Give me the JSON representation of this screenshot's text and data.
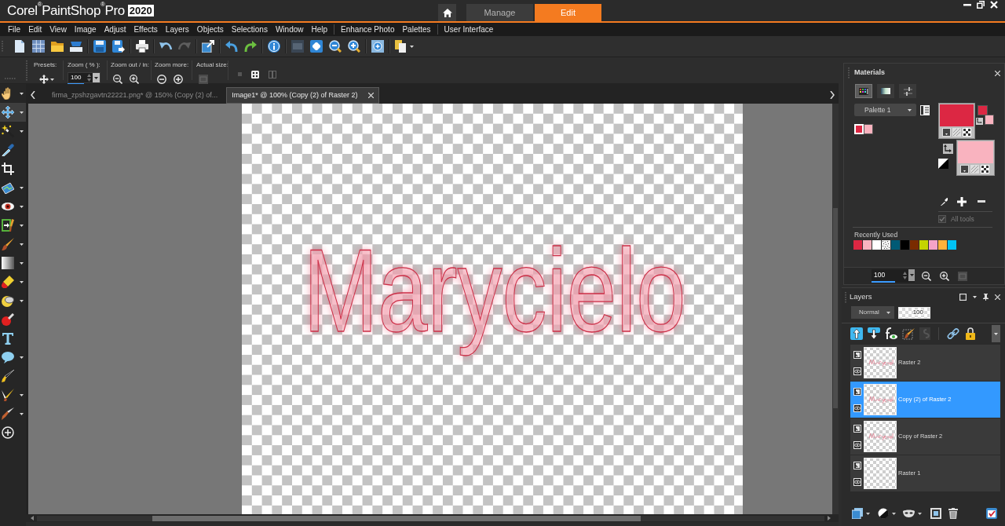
{
  "app": {
    "logo": "Corel$^{®}$PaintShop$^{®}$Pro",
    "edition": "2020",
    "workspace_tabs": [
      {
        "label": "Manage",
        "selected": false
      },
      {
        "label": "Edit",
        "selected": true
      }
    ]
  },
  "menu": [
    [
      "File",
      "Edit",
      "View",
      "Image",
      "Adjust",
      "Effects",
      "Layers",
      "Objects",
      "Selections",
      "Window",
      "Help"
    ],
    [
      "Enhance Photo",
      "Palettes"
    ],
    [
      "User Interface"
    ]
  ],
  "tool_options": {
    "presets": {
      "label": "Presets:"
    },
    "zoom": {
      "label": "Zoom ( % ):",
      "value": "100",
      "level": 0.5
    },
    "zoom_out_in": {
      "label": "Zoom out / in:"
    },
    "zoom_more": {
      "label": "Zoom more:"
    },
    "actual_size": {
      "label": "Actual size:"
    }
  },
  "toolbox": [
    {
      "kind": "pan",
      "selected": false,
      "flyout": true
    },
    {
      "kind": "move",
      "selected": true,
      "flyout": true
    },
    {
      "kind": "magic-wand",
      "selected": false,
      "flyout": true
    },
    {
      "kind": "dropper",
      "selected": false,
      "flyout": false
    },
    {
      "kind": "crop",
      "selected": false,
      "flyout": false
    },
    {
      "kind": "straighten",
      "selected": false,
      "flyout": true
    },
    {
      "kind": "red-eye",
      "selected": false,
      "flyout": true
    },
    {
      "kind": "resize",
      "selected": false,
      "flyout": true
    },
    {
      "kind": "paint-brush",
      "selected": false,
      "flyout": true
    },
    {
      "kind": "gradient",
      "selected": false,
      "flyout": true
    },
    {
      "kind": "eraser",
      "selected": false,
      "flyout": true
    },
    {
      "kind": "fill",
      "selected": false,
      "flyout": true
    },
    {
      "kind": "makeover",
      "selected": false,
      "flyout": false
    },
    {
      "kind": "text",
      "selected": false,
      "flyout": false
    },
    {
      "kind": "shape",
      "selected": false,
      "flyout": true
    },
    {
      "kind": "pen",
      "selected": false,
      "flyout": false
    },
    {
      "kind": "art-brush",
      "selected": false,
      "flyout": true
    },
    {
      "kind": "clone",
      "selected": false,
      "flyout": true
    },
    {
      "kind": "more",
      "selected": false,
      "flyout": false
    }
  ],
  "document_tabs": [
    {
      "label": "firma_zpshzgavtn22221.png* @ 150% (Copy (2) of...",
      "selected": false
    },
    {
      "label": "Image1* @ 100% (Copy (2) of Raster 2)",
      "selected": true
    }
  ],
  "canvas": {
    "artwork_text": "Marycielo"
  },
  "materials": {
    "title": "Materials",
    "tabs": [
      {
        "kind": "swatches",
        "selected": true
      },
      {
        "kind": "gradient",
        "selected": false
      },
      {
        "kind": "adjust",
        "selected": false
      }
    ],
    "palette": "Palette 1",
    "palette_swatches": [
      {
        "color": "#dc2743",
        "selected": true
      },
      {
        "color": "#f9b3bf",
        "selected": false
      }
    ],
    "properties": [
      {
        "kind": "foreground",
        "color": "#dc2743"
      },
      {
        "kind": "background",
        "color": "#f9b3bf"
      }
    ],
    "all_tools": {
      "label": "All tools",
      "checked": true,
      "disabled": true
    },
    "recently_used": {
      "title": "Recently Used",
      "swatches": [
        {
          "kind": "color",
          "color": "#dc2743"
        },
        {
          "kind": "color",
          "color": "#f9b3bf"
        },
        {
          "kind": "color",
          "color": "#ffffff"
        },
        {
          "kind": "pattern"
        },
        {
          "kind": "color",
          "color": "#005a75"
        },
        {
          "kind": "color",
          "color": "#000000"
        },
        {
          "kind": "color",
          "color": "#7a2b00"
        },
        {
          "kind": "color",
          "color": "#c5d400"
        },
        {
          "kind": "color",
          "color": "#f5a3c7"
        },
        {
          "kind": "color",
          "color": "#ffb23b"
        },
        {
          "kind": "color",
          "color": "#00c3f5"
        }
      ]
    },
    "zoom": {
      "value": "100",
      "level": 0.55
    }
  },
  "layers": {
    "title": "Layers",
    "blend_mode": "Normal",
    "opacity": "100",
    "items": [
      {
        "name": "Raster 2",
        "kind": "text-art",
        "visible": true,
        "selected": false
      },
      {
        "name": "Copy (2) of Raster 2",
        "kind": "text-art",
        "visible": true,
        "selected": true
      },
      {
        "name": "Copy of Raster 2",
        "kind": "text-art",
        "visible": true,
        "selected": false
      },
      {
        "name": "Raster 1",
        "kind": "blank",
        "visible": true,
        "selected": false
      }
    ]
  }
}
